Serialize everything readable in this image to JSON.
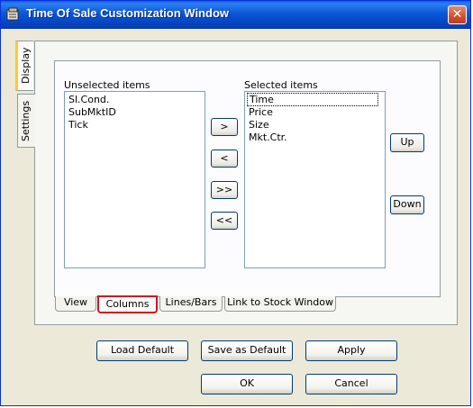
{
  "window": {
    "title": "Time Of Sale Customization Window",
    "close_glyph": "✕"
  },
  "side_tabs": [
    {
      "label": "Display",
      "active": true
    },
    {
      "label": "Settings",
      "active": false
    }
  ],
  "unselected": {
    "label": "Unselected items",
    "items": [
      "Sl.Cond.",
      "SubMktID",
      "Tick"
    ]
  },
  "selected": {
    "label": "Selected items",
    "items": [
      "Time",
      "Price",
      "Size",
      "Mkt.Ctr."
    ],
    "focused_item": "Time"
  },
  "move_buttons": {
    "add": ">",
    "remove": "<",
    "add_all": ">>",
    "remove_all": "<<"
  },
  "order_buttons": {
    "up": "Up",
    "down": "Down"
  },
  "bottom_tabs": [
    {
      "label": "View",
      "active": false
    },
    {
      "label": "Columns",
      "active": true
    },
    {
      "label": "Lines/Bars",
      "active": false
    },
    {
      "label": "Link to Stock Window",
      "active": false
    }
  ],
  "actions": {
    "load_default": "Load Default",
    "save_default": "Save as Default",
    "apply": "Apply",
    "ok": "OK",
    "cancel": "Cancel"
  }
}
